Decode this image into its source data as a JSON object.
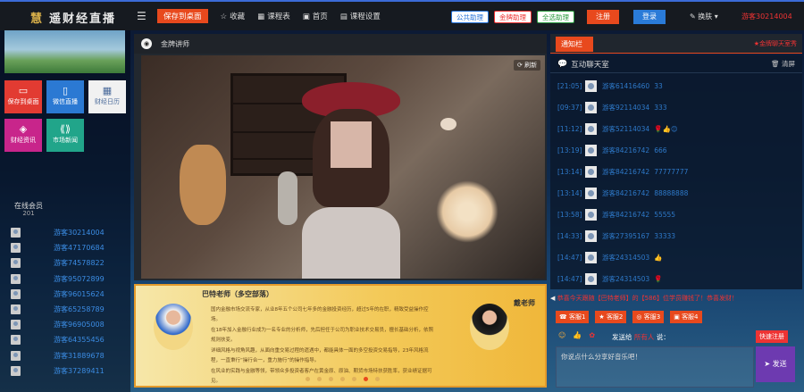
{
  "header": {
    "logo_mark": "慧",
    "logo_text": "遥财经直播",
    "menu": [
      "保存到桌面",
      "收藏",
      "课程表",
      "首页",
      "课程设置"
    ],
    "tags": [
      "公共助理",
      "金牌助理",
      "全选助理"
    ],
    "register": "注册",
    "login": "登录",
    "skin": "换肤",
    "user": "游客30214004"
  },
  "sidebar": {
    "tiles": [
      {
        "label": "保存到桌面",
        "icon": "monitor-icon",
        "color": "#e23b32"
      },
      {
        "label": "微信直播",
        "icon": "phone-icon",
        "color": "#2b79d3"
      },
      {
        "label": "财经日历",
        "icon": "calendar-icon",
        "color": "#f1f1f1"
      },
      {
        "label": "财经资讯",
        "icon": "news-icon",
        "color": "#c8258b"
      },
      {
        "label": "市场新闻",
        "icon": "market-icon",
        "color": "#21a58a"
      }
    ],
    "online_label": "在线会员",
    "online_count": "201",
    "members": [
      "游客30214004",
      "游客47170684",
      "游客74578822",
      "游客95072899",
      "游客96015624",
      "游客65258789",
      "游客96905008",
      "游客64355456",
      "游客31889678",
      "游客37289411"
    ]
  },
  "video": {
    "title": "金牌讲师",
    "refresh": "刷新"
  },
  "teacher": {
    "name": "巴特老师（多空部落）",
    "desc": [
      "国内金融市场交流专家，从业8年五个公司七年多的金融投资经历，超过5年的在职，精致受益操作控场。",
      "在18年加入金融行业成为一名专业的分析师，先后担任于公司为职业技术交易员，擅长基础分析，依照规则扶变。",
      "详细风格与视角风趣，从面向重交易过程的遗遇中，都能具体一面的多空投资交易指导，23年风格流程，一直秉行“操行合一，重力施行”的操作指导。",
      "在风业的实践与金融等领，带领众多投资者客户在黄金原、原油、期货市场特扶获胜率，获业绩证据可见。"
    ],
    "name2": "戴老师"
  },
  "notice": {
    "tab": "通知栏",
    "text": "★金牌聊天室秀"
  },
  "chat": {
    "title": "互动聊天室",
    "clear": "清屏",
    "messages": [
      {
        "time": "[21:05]",
        "user": "游客61416460",
        "text": "33"
      },
      {
        "time": "[09:37]",
        "user": "游客92114034",
        "text": "333"
      },
      {
        "time": "[11:12]",
        "user": "游客52114034",
        "text": "🌹👍😊"
      },
      {
        "time": "[13:19]",
        "user": "游客84216742",
        "text": "666"
      },
      {
        "time": "[13:14]",
        "user": "游客84216742",
        "text": "77777777"
      },
      {
        "time": "[13:14]",
        "user": "游客84216742",
        "text": "88888888"
      },
      {
        "time": "[13:58]",
        "user": "游客84216742",
        "text": "55555"
      },
      {
        "time": "[14:33]",
        "user": "游客27395167",
        "text": "33333"
      },
      {
        "time": "[14:47]",
        "user": "游客24314503",
        "text": "👍"
      },
      {
        "time": "[14:47]",
        "user": "游客24314503",
        "text": "🌹"
      }
    ],
    "marquee_lead": "◀",
    "marquee": "恭喜今天跟随【巴特老师】的【586】位学员赚钱了！恭喜发财！",
    "rooms": [
      "客服1",
      "客服2",
      "客服3",
      "客服4"
    ],
    "send_to_label": "发送给",
    "send_to_target": "所有人",
    "send_to_suffix": "说：",
    "quick": "快速注册",
    "placeholder": "你说点什么分享好音乐吧！",
    "send": "发送"
  }
}
